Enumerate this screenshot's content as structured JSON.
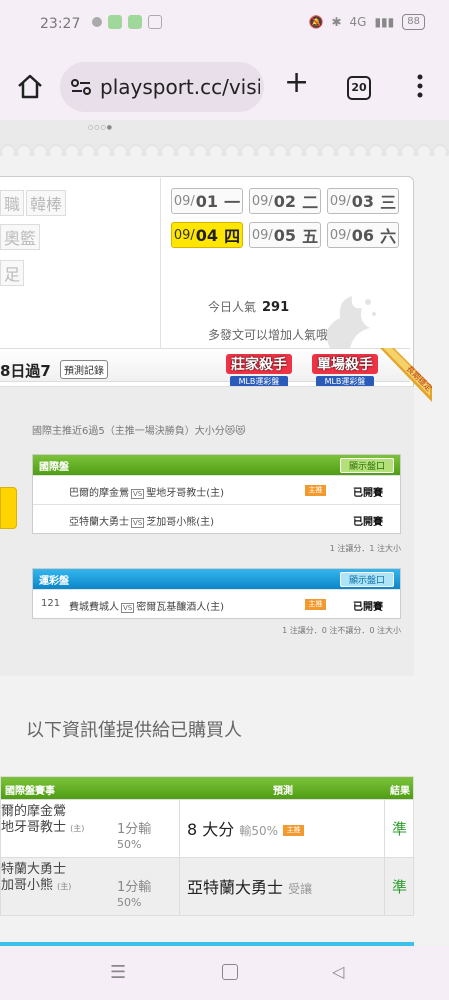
{
  "status": {
    "time": "23:27",
    "battery": "88",
    "net": "4G"
  },
  "browser": {
    "url": "playsport.cc/visit",
    "tab_count": "20"
  },
  "sports": [
    "職",
    "韓棒",
    "奧籃",
    "足"
  ],
  "dates": [
    {
      "month": "09/",
      "day": "01",
      "wd": "一",
      "active": false
    },
    {
      "month": "09/",
      "day": "02",
      "wd": "二",
      "active": false
    },
    {
      "month": "09/",
      "day": "03",
      "wd": "三",
      "active": false
    },
    {
      "month": "09/",
      "day": "04",
      "wd": "四",
      "active": true
    },
    {
      "month": "09/",
      "day": "05",
      "wd": "五",
      "active": false
    },
    {
      "month": "09/",
      "day": "06",
      "wd": "六",
      "active": false
    }
  ],
  "popularity": {
    "label": "今日人氣",
    "value": "291",
    "hint": "多發文可以增加人氣哦~"
  },
  "record": {
    "title": "8日過7",
    "button": "預測記錄"
  },
  "badges": [
    {
      "title": "莊家殺手",
      "sub": "MLB運彩盤"
    },
    {
      "title": "單場殺手",
      "sub": "MLB運彩盤"
    }
  ],
  "ribbon": "長期穩定",
  "notice": "國際主推近6過5（主推一場決勝負）大小分😻😻",
  "intl": {
    "title": "國際盤",
    "show_btn": "顯示盤口",
    "games": [
      {
        "no": "",
        "away": "巴爾的摩金鶯",
        "vs": "VS",
        "home": "聖地牙哥教士(主)",
        "tag": "主推",
        "state": "已開賽"
      },
      {
        "no": "",
        "away": "亞特蘭大勇士",
        "vs": "VS",
        "home": "芝加哥小熊(主)",
        "tag": "",
        "state": "已開賽"
      }
    ],
    "summary": "1 注讓分．1 注大小"
  },
  "lottery": {
    "title": "運彩盤",
    "show_btn": "顯示盤口",
    "games": [
      {
        "no": "121",
        "away": "費城費城人",
        "vs": "VS",
        "home": "密爾瓦基釀酒人(主)",
        "tag": "主推",
        "state": "已開賽"
      }
    ],
    "summary": "1 注讓分．0 注不讓分．0 注大小"
  },
  "info_line": "以下資訊僅提供給已購買人",
  "table": {
    "headers": {
      "event": "國際盤賽事",
      "prediction": "預測",
      "result": "結果"
    },
    "rows": [
      {
        "l1": "爾的摩金鶯",
        "l2": "地牙哥教士",
        "home": "(主)",
        "odds": "1分輸",
        "pct": "50%",
        "pred": "8 大分",
        "pred_note": "輸50%",
        "pred_tag": "主推",
        "result": "準"
      },
      {
        "l1": "特蘭大勇士",
        "l2": "加哥小熊",
        "home": "(主)",
        "odds": "1分輸",
        "pct": "50%",
        "pred": "亞特蘭大勇士",
        "pred_note": "受讓",
        "pred_tag": "",
        "result": "準"
      }
    ]
  }
}
